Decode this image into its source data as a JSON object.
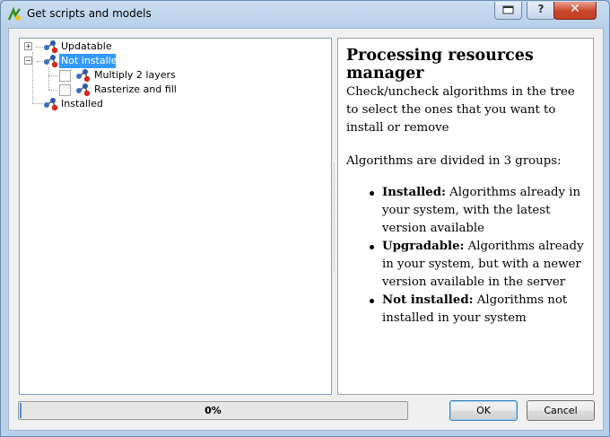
{
  "window": {
    "title": "Get scripts and models",
    "buttons": {
      "help": "?",
      "close": "✕"
    }
  },
  "tree": {
    "groups": [
      {
        "label": "Updatable",
        "expanded": false,
        "selected": false
      },
      {
        "label": "Not installed",
        "expanded": true,
        "selected": true,
        "children": [
          {
            "label": "Multiply 2 layers",
            "checked": false
          },
          {
            "label": "Rasterize and fill",
            "checked": false
          }
        ]
      },
      {
        "label": "Installed",
        "expanded": false,
        "selected": false
      }
    ]
  },
  "info": {
    "heading": "Processing resources manager",
    "paragraph1": "Check/uncheck algorithms in the tree to select the ones that you want to install or remove",
    "paragraph2": "Algorithms are divided in 3 groups:",
    "items": [
      {
        "term": "Installed:",
        "desc": " Algorithms already in your system, with the latest version available"
      },
      {
        "term": "Upgradable:",
        "desc": " Algorithms already in your system, but with a newer version available in the server"
      },
      {
        "term": "Not installed:",
        "desc": " Algorithms not installed in your system"
      }
    ]
  },
  "progress": {
    "value": 0,
    "label": "0%"
  },
  "buttons": {
    "ok": "OK",
    "cancel": "Cancel"
  },
  "colors": {
    "selection": "#3399ff",
    "progress_fill": "#4d8fd6"
  }
}
